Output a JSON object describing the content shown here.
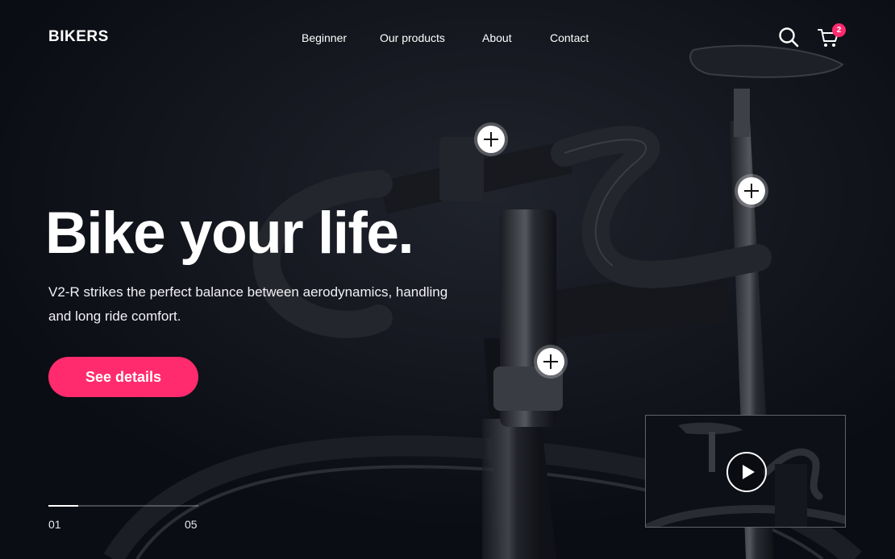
{
  "brand": {
    "logo": "BIKERS"
  },
  "nav": {
    "items": [
      "Beginner",
      "Our products",
      "About",
      "Contact"
    ]
  },
  "header": {
    "search_icon": "search-icon",
    "cart_icon": "cart-icon",
    "cart_count": "2"
  },
  "hero": {
    "title": "Bike your life.",
    "subtitle": "V2-R strikes the perfect balance between aerodynamics, handling and long ride comfort.",
    "cta": "See details"
  },
  "hotspots": [
    "plus-icon",
    "plus-icon",
    "plus-icon"
  ],
  "slider": {
    "current": "01",
    "total": "05",
    "progress": 0.2
  },
  "video": {
    "icon": "play-icon"
  },
  "colors": {
    "background": "#0b0d14",
    "accent": "#ff2b6e",
    "text": "#ffffff"
  }
}
